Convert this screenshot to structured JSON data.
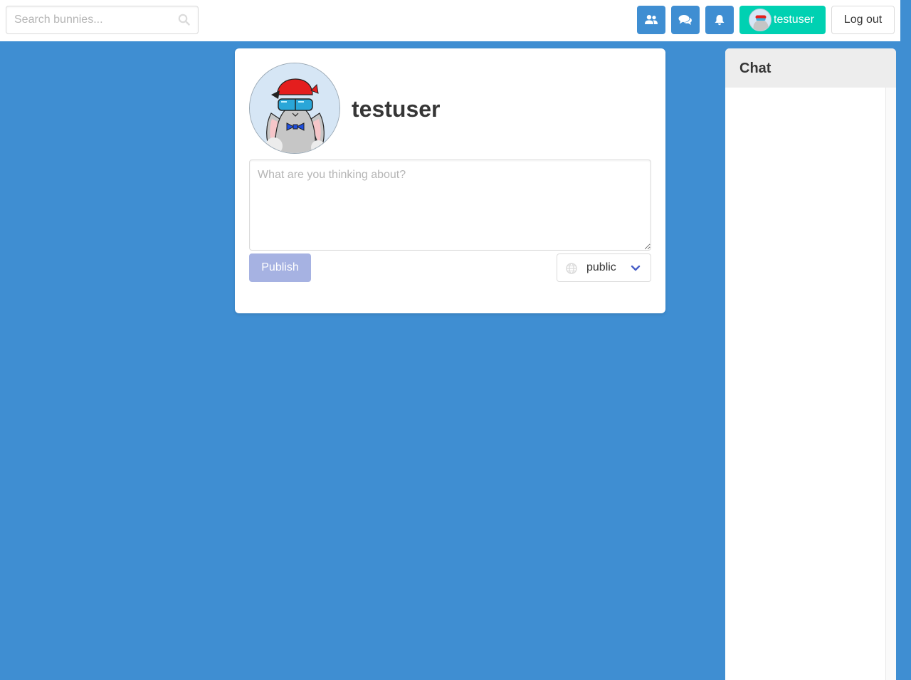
{
  "search": {
    "placeholder": "Search bunnies...",
    "icon": "search-icon"
  },
  "nav": {
    "friends_icon": "users-icon",
    "messages_icon": "comments-icon",
    "notifications_icon": "bell-icon",
    "user_label": "testuser",
    "logout_label": "Log out"
  },
  "profile": {
    "username": "testuser"
  },
  "composer": {
    "placeholder": "What are you thinking about?",
    "publish_label": "Publish",
    "visibility": "public"
  },
  "chat": {
    "title": "Chat"
  },
  "colors": {
    "background": "#3f8ed2",
    "nav_button": "#3f8ed2",
    "user_button": "#00d1b2",
    "publish_disabled": "#a6b2e2",
    "chat_header": "#ededed",
    "chevron": "#485fc7"
  }
}
